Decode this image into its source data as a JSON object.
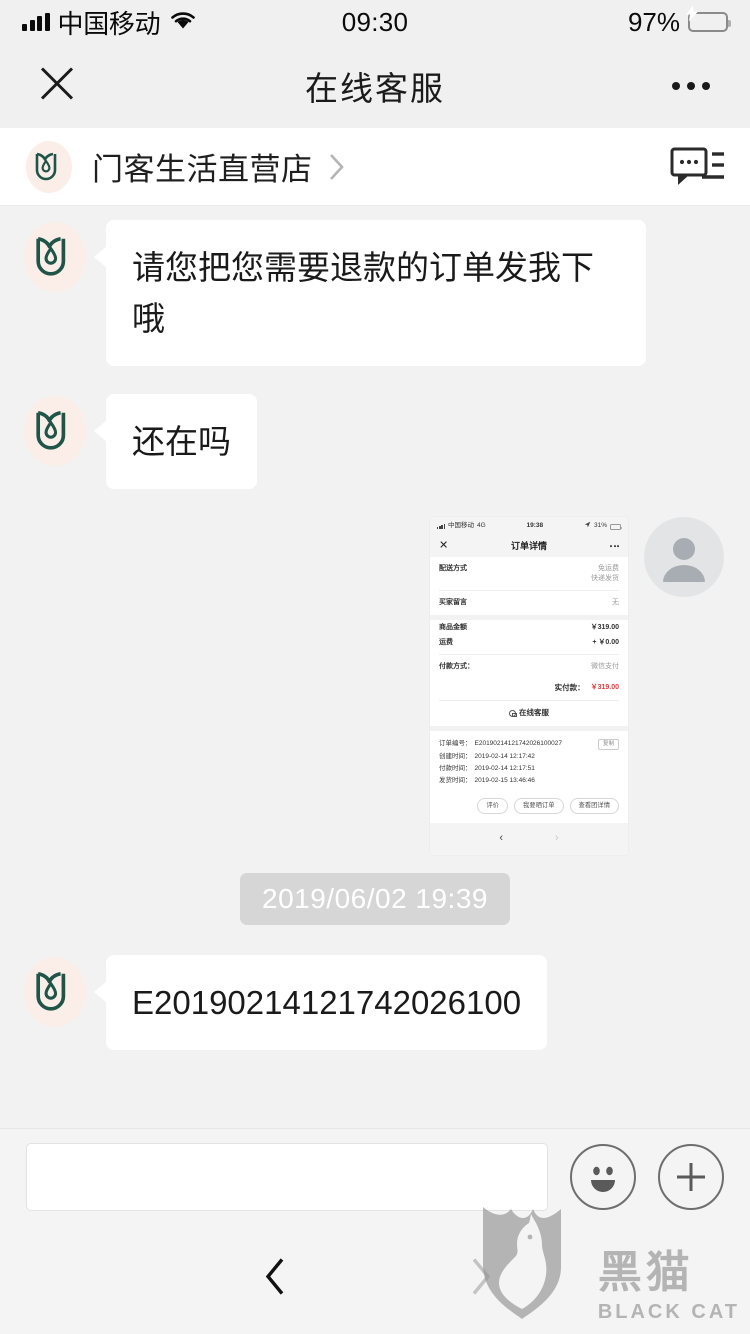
{
  "status_bar": {
    "carrier": "中国移动",
    "time": "09:30",
    "battery_text": "97%",
    "signal_icon": "signal-bars-icon",
    "wifi_icon": "wifi-icon",
    "battery_icon": "battery-charging-icon"
  },
  "nav": {
    "title": "在线客服",
    "close_icon": "close-icon",
    "more_icon": "more-options-icon"
  },
  "shop": {
    "name": "门客生活直营店",
    "logo_icon": "shop-tulip-logo-icon",
    "chevron_icon": "chevron-right-icon",
    "quick_reply_icon": "quick-reply-chat-icon",
    "logo_bg": "#fbeee8",
    "logo_stroke": "#1f5448"
  },
  "messages": [
    {
      "id": "msg-1",
      "sender": "shop",
      "type": "text",
      "text": "请您把您需要退款的订单发我下哦"
    },
    {
      "id": "msg-2",
      "sender": "shop",
      "type": "text",
      "text": "还在吗"
    },
    {
      "id": "msg-3",
      "sender": "user",
      "type": "image",
      "alt": "订单详情截图"
    },
    {
      "id": "msg-4",
      "sender": "shop",
      "type": "text",
      "text": "E20190214121742026100"
    }
  ],
  "timestamp": "2019/06/02 19:39",
  "order_screenshot": {
    "status_bar": {
      "carrier": "中国移动",
      "network": "4G",
      "time": "19:38",
      "battery_text": "31%"
    },
    "nav_title": "订单详情",
    "rows": [
      {
        "key": "配送方式",
        "value": "免运费",
        "value2": "快递发货"
      },
      {
        "key": "买家留言",
        "value": "无"
      }
    ],
    "amounts": [
      {
        "key": "商品金额",
        "value": "￥319.00"
      },
      {
        "key": "运费",
        "value": "+ ￥0.00"
      }
    ],
    "pay_method_label": "付款方式：",
    "pay_method_value": "微信支付",
    "total_label": "实付款：",
    "total_value": "￥319.00",
    "customer_service": "在线客服",
    "meta": [
      {
        "key": "订单编号：",
        "value": "E20190214121742026100027",
        "action": "复制"
      },
      {
        "key": "创建时间：",
        "value": "2019-02-14 12:17:42"
      },
      {
        "key": "付款时间：",
        "value": "2019-02-14 12:17:51"
      },
      {
        "key": "发货时间：",
        "value": "2019-02-15 13:46:46"
      }
    ],
    "buttons": [
      "评价",
      "我要晒订单",
      "查看团详情"
    ],
    "nav_back_icon": "chevron-left-icon",
    "nav_forward_icon": "chevron-right-icon"
  },
  "input_bar": {
    "value": "",
    "placeholder": "",
    "emoji_icon": "emoji-smiley-icon",
    "plus_icon": "plus-circle-icon"
  },
  "bottom_bar": {
    "back_icon": "chevron-left-icon",
    "forward_icon": "chevron-right-icon"
  },
  "watermark": {
    "cn": "黑猫",
    "en": "BLACK CAT",
    "icon": "black-cat-shield-logo-icon"
  }
}
